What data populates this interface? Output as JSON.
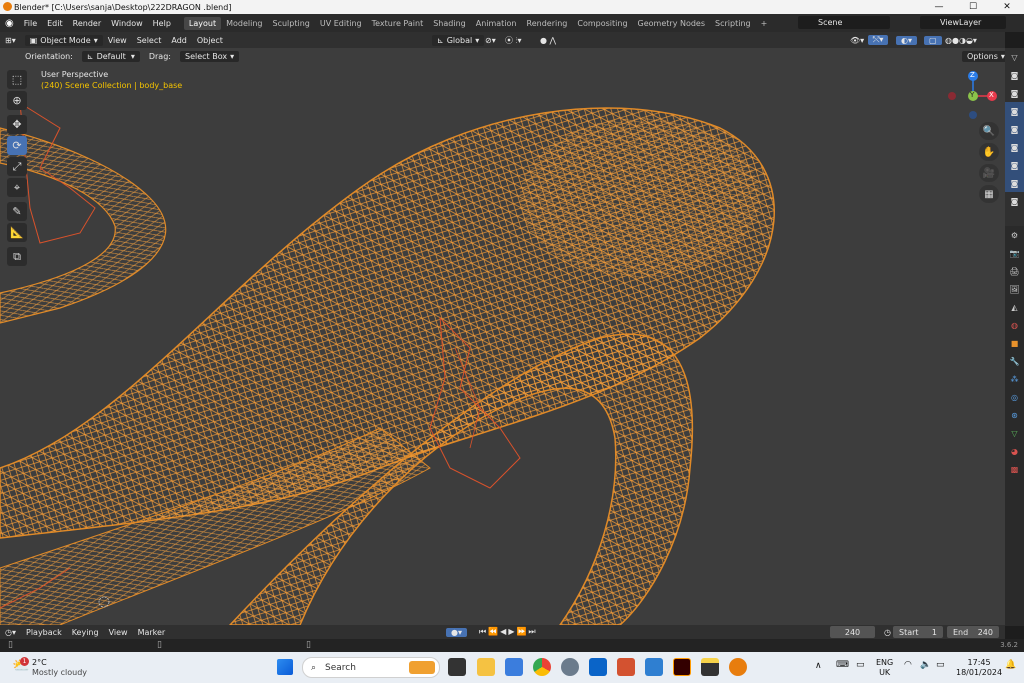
{
  "window": {
    "title": "Blender* [C:\\Users\\sanja\\Desktop\\222DRAGON .blend]",
    "min": "—",
    "max": "☐",
    "close": "✕"
  },
  "menu": [
    "File",
    "Edit",
    "Render",
    "Window",
    "Help"
  ],
  "workspaces": [
    "Layout",
    "Modeling",
    "Sculpting",
    "UV Editing",
    "Texture Paint",
    "Shading",
    "Animation",
    "Rendering",
    "Compositing",
    "Geometry Nodes",
    "Scripting",
    "+"
  ],
  "scene": {
    "name": "Scene",
    "view_layer": "ViewLayer"
  },
  "toolbar": {
    "mode": "Object Mode",
    "menus": [
      "View",
      "Select",
      "Add",
      "Object"
    ],
    "transform": "Global",
    "orientation_label": "Orientation:",
    "orientation_value": "Default",
    "drag_label": "Drag:",
    "drag_value": "Select Box",
    "options": "Options"
  },
  "viewport": {
    "perspective": "User Perspective",
    "collection": "(240) Scene Collection | body_base",
    "gizmo": {
      "z": "Z",
      "y": "Y",
      "x": "X"
    }
  },
  "timeline": {
    "menus": [
      "Playback",
      "Keying",
      "View",
      "Marker"
    ],
    "current_frame": "240",
    "start_label": "Start",
    "start_value": "1",
    "end_label": "End",
    "end_value": "240"
  },
  "status": {
    "version": "3.6.2"
  },
  "taskbar": {
    "temp": "2°C",
    "weather": "Mostly cloudy",
    "badge": "1",
    "search": "Search",
    "lang1": "ENG",
    "lang2": "UK",
    "time": "17:45",
    "date": "18/01/2024"
  },
  "colors": {
    "accent": "#4772b3",
    "wire": "#e8922c",
    "viewport_bg": "#3d3d3d"
  }
}
